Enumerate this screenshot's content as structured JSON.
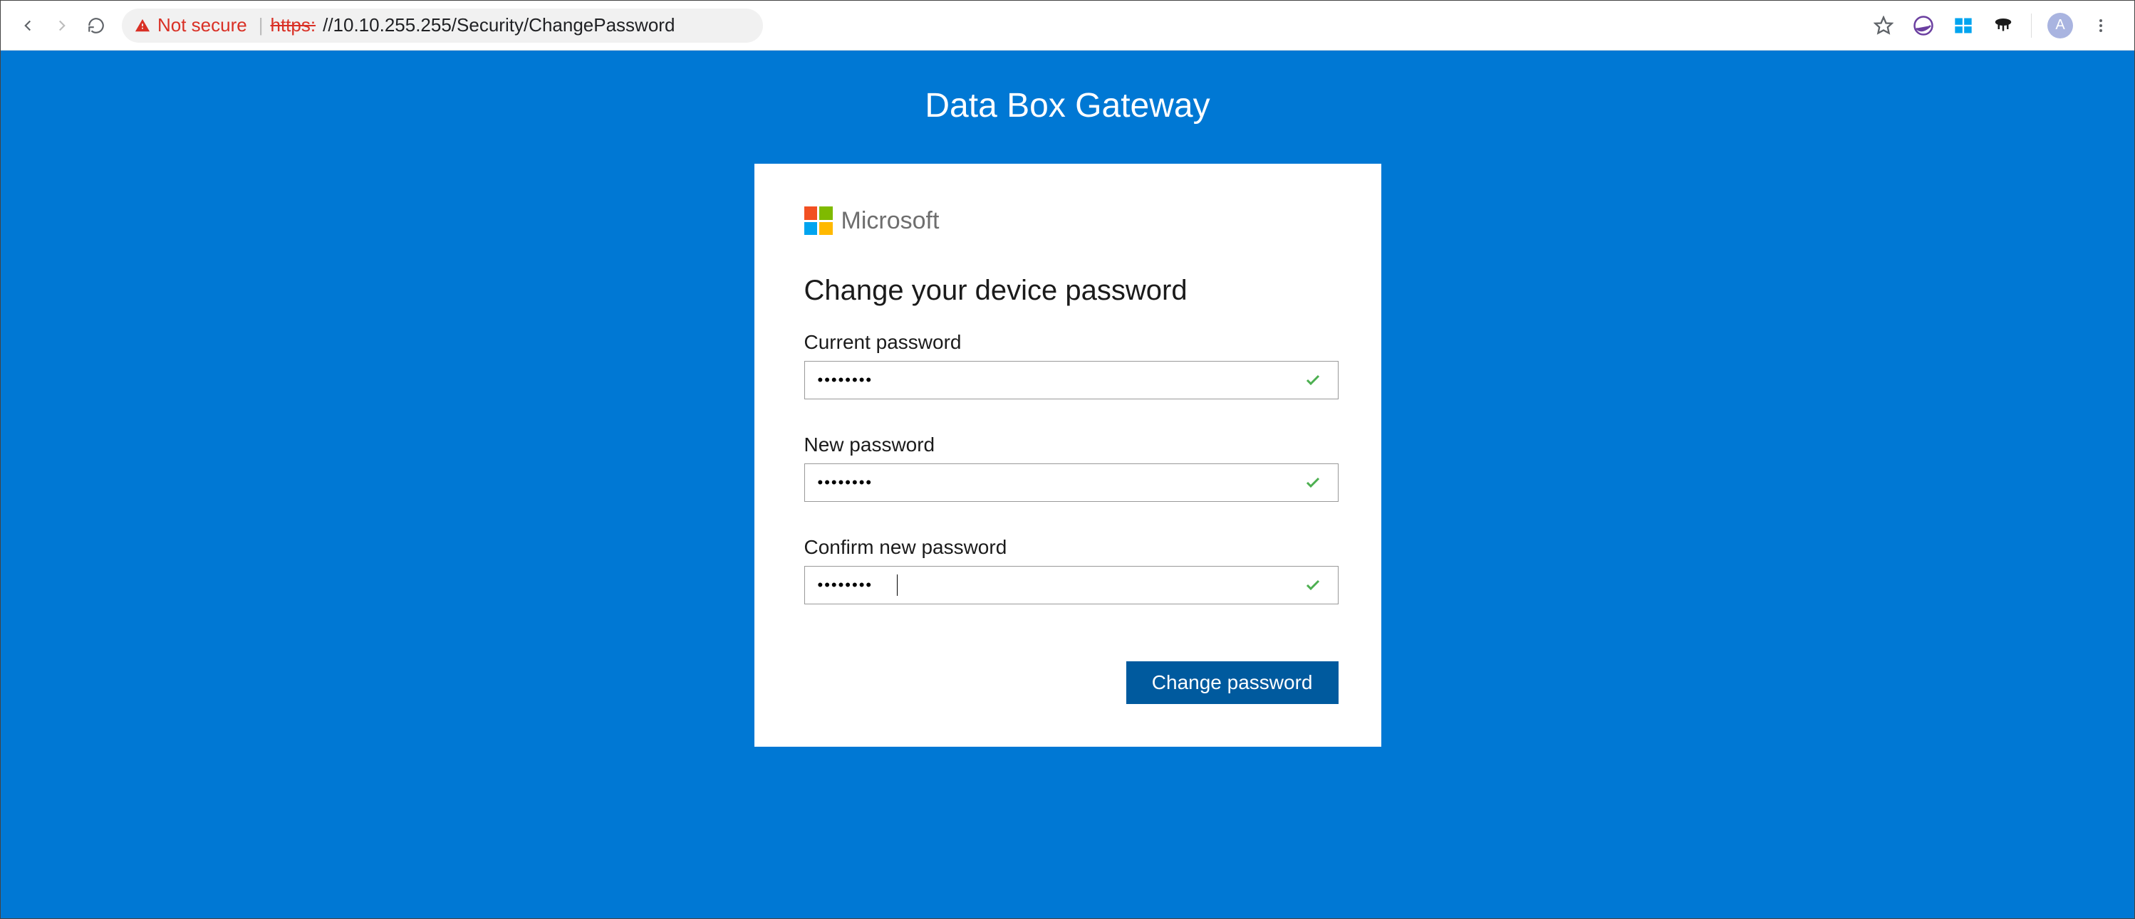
{
  "browser": {
    "not_secure_label": "Not secure",
    "https_label": "https:",
    "url_rest": "//10.10.255.255/Security/ChangePassword",
    "avatar_initial": "A"
  },
  "page": {
    "title": "Data Box Gateway",
    "brand": "Microsoft",
    "heading": "Change your device password",
    "fields": {
      "current": {
        "label": "Current password",
        "value": "••••••••"
      },
      "new": {
        "label": "New password",
        "value": "••••••••"
      },
      "confirm": {
        "label": "Confirm new password",
        "value": "••••••••"
      }
    },
    "button": "Change password"
  }
}
